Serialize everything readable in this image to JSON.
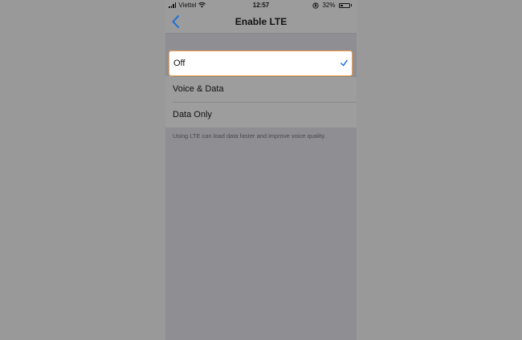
{
  "status_bar": {
    "carrier": "Viettel",
    "time": "12:57",
    "battery_percent": "32%",
    "battery_level": 0.32,
    "icons": [
      "signal-icon",
      "wifi-icon",
      "orientation-lock-icon",
      "battery-icon"
    ]
  },
  "nav": {
    "title": "Enable LTE",
    "back_icon": "chevron-left-icon"
  },
  "options": [
    {
      "label": "Off",
      "selected": true
    },
    {
      "label": "Voice & Data",
      "selected": false
    },
    {
      "label": "Data Only",
      "selected": false
    }
  ],
  "footer": {
    "note": "Using LTE can load data faster and improve voice quality."
  },
  "colors": {
    "accent": "#1a6ed8",
    "highlight_border": "#f0a049",
    "dim_overlay": "#999999"
  }
}
